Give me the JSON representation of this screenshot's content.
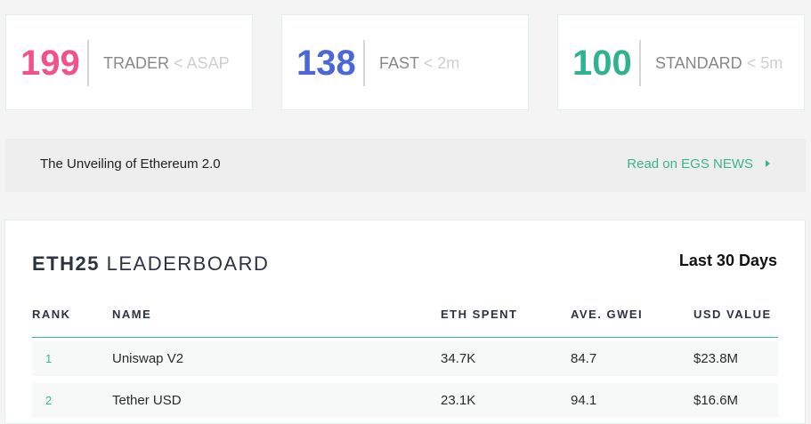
{
  "gas_prices": [
    {
      "value": "199",
      "speed": "TRADER",
      "eta": "< ASAP",
      "color": "#f0538b"
    },
    {
      "value": "138",
      "speed": "FAST",
      "eta": "< 2m",
      "color": "#4a66d8"
    },
    {
      "value": "100",
      "speed": "STANDARD",
      "eta": "< 5m",
      "color": "#2fb28f"
    }
  ],
  "news": {
    "headline": "The Unveiling of Ethereum 2.0",
    "link_label": "Read on EGS NEWS",
    "link_icon": "play-triangle-icon"
  },
  "leaderboard": {
    "title_strong": "ETH25",
    "title_rest": "LEADERBOARD",
    "period": "Last 30 Days",
    "columns": {
      "rank": "RANK",
      "name": "NAME",
      "eth_spent": "ETH SPENT",
      "ave_gwei": "AVE. GWEI",
      "usd_value": "USD VALUE"
    },
    "rows": [
      {
        "rank": "1",
        "name": "Uniswap V2",
        "eth_spent": "34.7K",
        "ave_gwei": "84.7",
        "usd_value": "$23.8M"
      },
      {
        "rank": "2",
        "name": "Tether USD",
        "eth_spent": "23.1K",
        "ave_gwei": "94.1",
        "usd_value": "$16.6M"
      }
    ]
  },
  "colors": {
    "accent_green": "#3ab58f",
    "page_background": "#f4f4f4",
    "banner_background": "#eeeeee"
  }
}
